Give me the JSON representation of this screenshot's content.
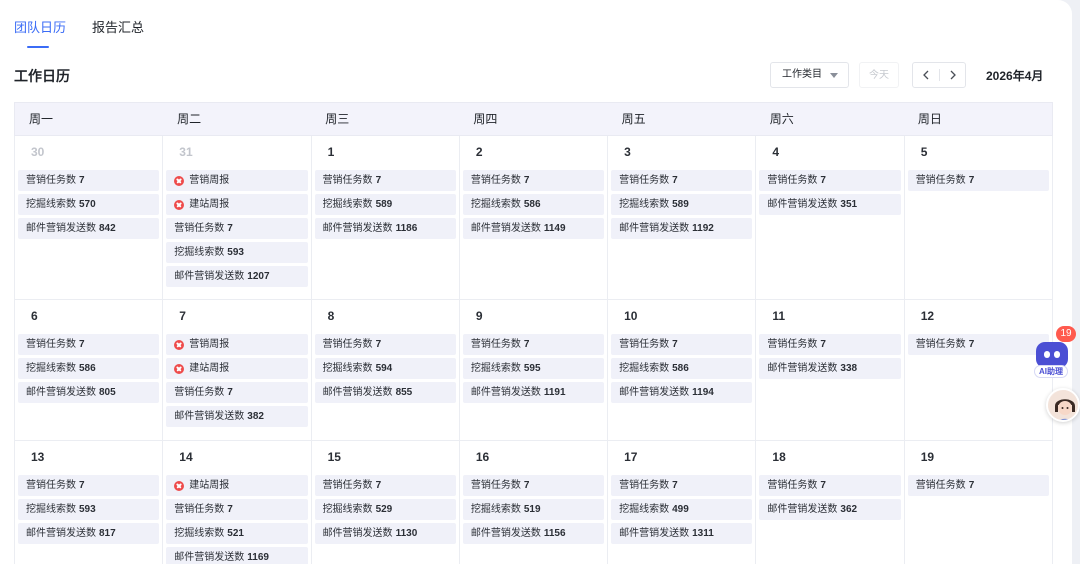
{
  "tabs": [
    {
      "label": "团队日历",
      "active": true
    },
    {
      "label": "报告汇总",
      "active": false
    }
  ],
  "page_title": "工作日历",
  "toolbar": {
    "type_select": "工作类目",
    "today": "今天",
    "month": "2026年4月"
  },
  "weekdays": [
    "周一",
    "周二",
    "周三",
    "周四",
    "周五",
    "周六",
    "周日"
  ],
  "weeks": [
    [
      {
        "day": "30",
        "muted": true,
        "items": [
          {
            "label": "营销任务数",
            "value": "7"
          },
          {
            "label": "挖掘线索数",
            "value": "570"
          },
          {
            "label": "邮件营销发送数",
            "value": "842"
          }
        ]
      },
      {
        "day": "31",
        "muted": true,
        "items": [
          {
            "label": "营销周报",
            "report": true
          },
          {
            "label": "建站周报",
            "report": true
          },
          {
            "label": "营销任务数",
            "value": "7"
          },
          {
            "label": "挖掘线索数",
            "value": "593"
          },
          {
            "label": "邮件营销发送数",
            "value": "1207"
          }
        ]
      },
      {
        "day": "1",
        "items": [
          {
            "label": "营销任务数",
            "value": "7"
          },
          {
            "label": "挖掘线索数",
            "value": "589"
          },
          {
            "label": "邮件营销发送数",
            "value": "1186"
          }
        ]
      },
      {
        "day": "2",
        "items": [
          {
            "label": "营销任务数",
            "value": "7"
          },
          {
            "label": "挖掘线索数",
            "value": "586"
          },
          {
            "label": "邮件营销发送数",
            "value": "1149"
          }
        ]
      },
      {
        "day": "3",
        "items": [
          {
            "label": "营销任务数",
            "value": "7"
          },
          {
            "label": "挖掘线索数",
            "value": "589"
          },
          {
            "label": "邮件营销发送数",
            "value": "1192"
          }
        ]
      },
      {
        "day": "4",
        "items": [
          {
            "label": "营销任务数",
            "value": "7"
          },
          {
            "label": "邮件营销发送数",
            "value": "351"
          }
        ]
      },
      {
        "day": "5",
        "items": [
          {
            "label": "营销任务数",
            "value": "7"
          }
        ]
      }
    ],
    [
      {
        "day": "6",
        "items": [
          {
            "label": "营销任务数",
            "value": "7"
          },
          {
            "label": "挖掘线索数",
            "value": "586"
          },
          {
            "label": "邮件营销发送数",
            "value": "805"
          }
        ]
      },
      {
        "day": "7",
        "items": [
          {
            "label": "营销周报",
            "report": true
          },
          {
            "label": "建站周报",
            "report": true
          },
          {
            "label": "营销任务数",
            "value": "7"
          },
          {
            "label": "邮件营销发送数",
            "value": "382"
          }
        ]
      },
      {
        "day": "8",
        "items": [
          {
            "label": "营销任务数",
            "value": "7"
          },
          {
            "label": "挖掘线索数",
            "value": "594"
          },
          {
            "label": "邮件营销发送数",
            "value": "855"
          }
        ]
      },
      {
        "day": "9",
        "items": [
          {
            "label": "营销任务数",
            "value": "7"
          },
          {
            "label": "挖掘线索数",
            "value": "595"
          },
          {
            "label": "邮件营销发送数",
            "value": "1191"
          }
        ]
      },
      {
        "day": "10",
        "items": [
          {
            "label": "营销任务数",
            "value": "7"
          },
          {
            "label": "挖掘线索数",
            "value": "586"
          },
          {
            "label": "邮件营销发送数",
            "value": "1194"
          }
        ]
      },
      {
        "day": "11",
        "items": [
          {
            "label": "营销任务数",
            "value": "7"
          },
          {
            "label": "邮件营销发送数",
            "value": "338"
          }
        ]
      },
      {
        "day": "12",
        "items": [
          {
            "label": "营销任务数",
            "value": "7"
          }
        ]
      }
    ],
    [
      {
        "day": "13",
        "items": [
          {
            "label": "营销任务数",
            "value": "7"
          },
          {
            "label": "挖掘线索数",
            "value": "593"
          },
          {
            "label": "邮件营销发送数",
            "value": "817"
          }
        ]
      },
      {
        "day": "14",
        "items": [
          {
            "label": "建站周报",
            "report": true
          },
          {
            "label": "营销任务数",
            "value": "7"
          },
          {
            "label": "挖掘线索数",
            "value": "521"
          },
          {
            "label": "邮件营销发送数",
            "value": "1169"
          }
        ]
      },
      {
        "day": "15",
        "items": [
          {
            "label": "营销任务数",
            "value": "7"
          },
          {
            "label": "挖掘线索数",
            "value": "529"
          },
          {
            "label": "邮件营销发送数",
            "value": "1130"
          }
        ]
      },
      {
        "day": "16",
        "items": [
          {
            "label": "营销任务数",
            "value": "7"
          },
          {
            "label": "挖掘线索数",
            "value": "519"
          },
          {
            "label": "邮件营销发送数",
            "value": "1156"
          }
        ]
      },
      {
        "day": "17",
        "items": [
          {
            "label": "营销任务数",
            "value": "7"
          },
          {
            "label": "挖掘线索数",
            "value": "499"
          },
          {
            "label": "邮件营销发送数",
            "value": "1311"
          }
        ]
      },
      {
        "day": "18",
        "items": [
          {
            "label": "营销任务数",
            "value": "7"
          },
          {
            "label": "邮件营销发送数",
            "value": "362"
          }
        ]
      },
      {
        "day": "19",
        "items": [
          {
            "label": "营销任务数",
            "value": "7"
          }
        ]
      }
    ]
  ],
  "assistant": {
    "badge": "19",
    "label": "AI助理",
    "icon": "robot-icon"
  },
  "avatar_icon": "user-avatar"
}
